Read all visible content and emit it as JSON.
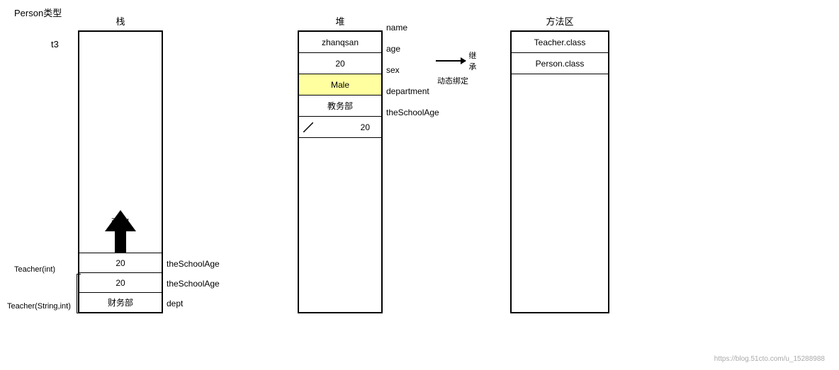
{
  "diagram": {
    "person_type_label": "Person类型",
    "stack": {
      "title": "栈",
      "t3_label": "t3",
      "popup_label": "弹出",
      "rows": [
        {
          "value": "20",
          "right_label": "theSchoolAge"
        },
        {
          "value": "20",
          "right_label": "theSchoolAge"
        },
        {
          "value": "财务部",
          "right_label": "dept"
        }
      ],
      "teacher_int_label": "Teacher(int)",
      "teacher_string_int_label": "Teacher(String,int)"
    },
    "heap": {
      "title": "堆",
      "rows": [
        {
          "value": "zhanqsan",
          "label": "name"
        },
        {
          "value": "20",
          "label": "age"
        },
        {
          "value": "Male",
          "label": "sex",
          "highlight": true
        },
        {
          "value": "教务部",
          "label": "department"
        },
        {
          "value": "20",
          "label": "theSchoolAge",
          "has_cross": true
        }
      ]
    },
    "inheritance": {
      "label": "继承",
      "dynamic_bind_label": "动态绑定"
    },
    "method_area": {
      "title": "方法区",
      "rows": [
        {
          "value": "Teacher.class"
        },
        {
          "value": "Person.class"
        }
      ]
    },
    "watermark": "https://blog.51cto.com/u_15288988"
  }
}
